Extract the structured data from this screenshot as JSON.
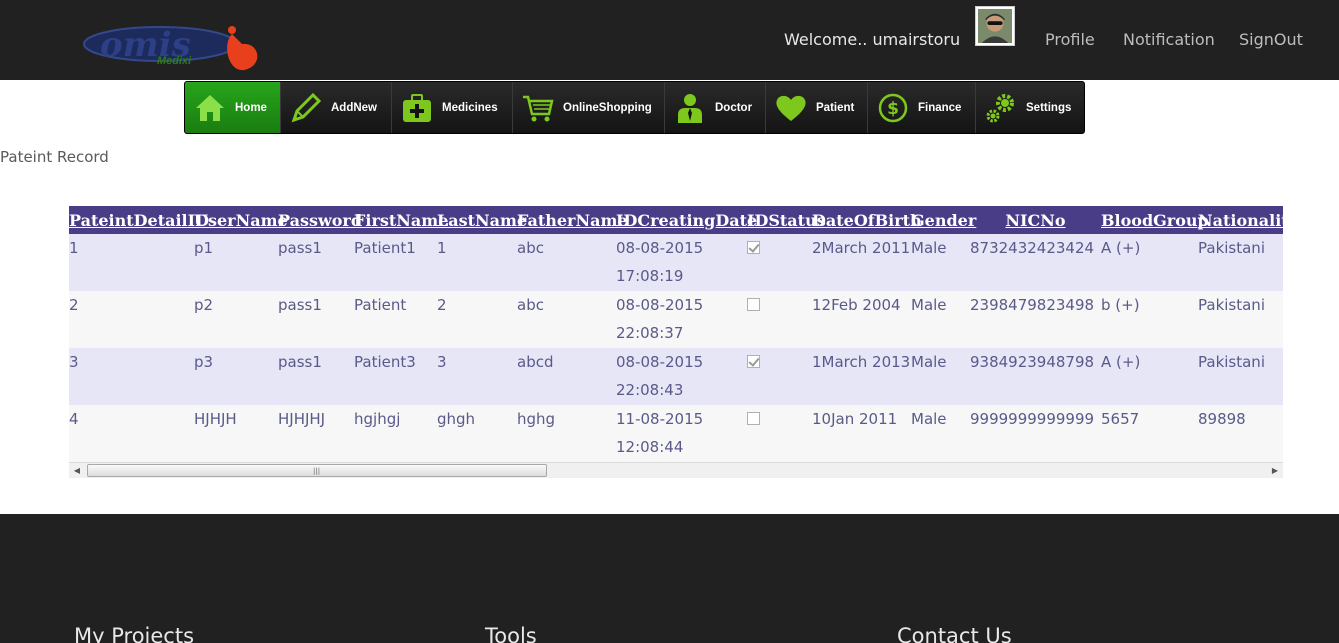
{
  "header": {
    "logo_text": "omis",
    "logo_sub": "Medixi",
    "welcome": "Welcome.. umairstoru",
    "links": [
      "Profile",
      "Notification",
      "SignOut"
    ]
  },
  "nav": [
    {
      "label": "Home",
      "icon": "home-icon",
      "active": true
    },
    {
      "label": "AddNew",
      "icon": "pencil-icon",
      "active": false
    },
    {
      "label": "Medicines",
      "icon": "medical-kit-icon",
      "active": false
    },
    {
      "label": "OnlineShopping",
      "icon": "shopping-cart-icon",
      "active": false
    },
    {
      "label": "Doctor",
      "icon": "doctor-icon",
      "active": false
    },
    {
      "label": "Patient",
      "icon": "heart-icon",
      "active": false
    },
    {
      "label": "Finance",
      "icon": "dollar-icon",
      "active": false
    },
    {
      "label": "Settings",
      "icon": "gears-icon",
      "active": false
    }
  ],
  "page_heading": "Pateint Record",
  "table": {
    "columns": [
      "PateintDetailID",
      "UserName",
      "Password",
      "FirstName",
      "LastName",
      "FatherName",
      "IDCreatingDate",
      "IDStatus",
      "DateOfBirth",
      "Gender",
      "NICNo",
      "BloodGroup",
      "Nationality"
    ],
    "rows": [
      {
        "id": "1",
        "username": "p1",
        "password": "pass1",
        "first": "Patient1",
        "last": "1",
        "father": "abc",
        "created": "08-08-2015 17:08:19",
        "status": true,
        "dob": "2March 2011",
        "gender": "Male",
        "nic": "8732432423424",
        "blood": "A (+)",
        "nationality": "Pakistani"
      },
      {
        "id": "2",
        "username": "p2",
        "password": "pass1",
        "first": "Patient",
        "last": "2",
        "father": "abc",
        "created": "08-08-2015 22:08:37",
        "status": false,
        "dob": "12Feb 2004",
        "gender": "Male",
        "nic": "2398479823498",
        "blood": "b (+)",
        "nationality": "Pakistani"
      },
      {
        "id": "3",
        "username": "p3",
        "password": "pass1",
        "first": "Patient3",
        "last": "3",
        "father": "abcd",
        "created": "08-08-2015 22:08:43",
        "status": true,
        "dob": "1March 2013",
        "gender": "Male",
        "nic": "9384923948798",
        "blood": "A (+)",
        "nationality": "Pakistani"
      },
      {
        "id": "4",
        "username": "HJHJH",
        "password": "HJHJHJ",
        "first": "hgjhgj",
        "last": "ghgh",
        "father": "hghg",
        "created": "11-08-2015 12:08:44",
        "status": false,
        "dob": "10Jan 2011",
        "gender": "Male",
        "nic": "9999999999999",
        "blood": "5657",
        "nationality": "89898"
      }
    ]
  },
  "footer": {
    "headings": [
      "My Projects",
      "Tools",
      "Contact Us"
    ]
  },
  "colors": {
    "header_bg": "#212121",
    "nav_active": "#26a51a",
    "icon_green": "#7ec81e",
    "table_header": "#4a3d87",
    "row_alt": "#e6e6f7",
    "row_norm": "#f7f7f7"
  }
}
